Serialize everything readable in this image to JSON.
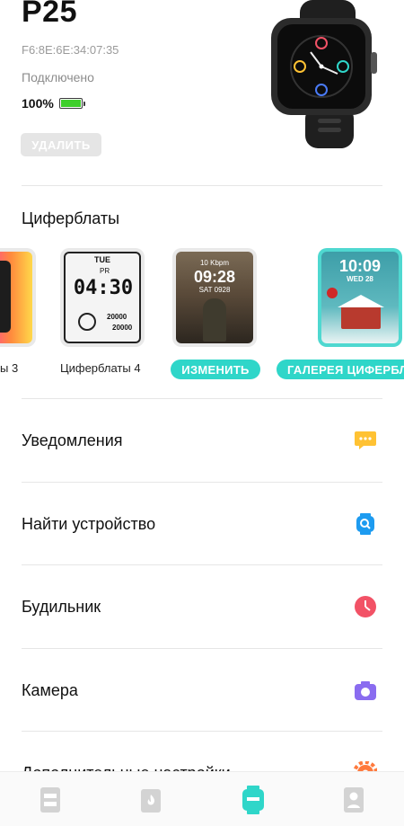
{
  "device": {
    "name": "P25",
    "mac": "F6:8E:6E:34:07:35",
    "status": "Подключено",
    "battery": "100%",
    "battery_level": 1.0,
    "delete_label": "УДАЛИТЬ"
  },
  "faces": {
    "title": "Циферблаты",
    "items": [
      {
        "label": "ы 3"
      },
      {
        "label": "Циферблаты 4",
        "time": "04:30",
        "day": "TUE",
        "ampm": "PR",
        "steps1": "20000",
        "steps2": "20000"
      },
      {
        "label": "",
        "time": "09:28",
        "sub": "10 Kbpm",
        "date": "SAT 0928"
      },
      {
        "label": "",
        "time": "10:09",
        "date": "WED 28"
      }
    ],
    "change_label": "ИЗМЕНИТЬ",
    "gallery_label": "ГАЛЕРЕЯ ЦИФЕРБЛАТОВ"
  },
  "menu": [
    {
      "label": "Уведомления",
      "icon": "message-icon",
      "color": "#ffc233"
    },
    {
      "label": "Найти устройство",
      "icon": "find-device-icon",
      "color": "#1d9bf0"
    },
    {
      "label": "Будильник",
      "icon": "alarm-clock-icon",
      "color": "#f25266"
    },
    {
      "label": "Камера",
      "icon": "camera-icon",
      "color": "#8a6cf0"
    },
    {
      "label": "Дополнительные настройки",
      "icon": "settings-gear-icon",
      "color": "#ff7a3d"
    }
  ],
  "nav": [
    "device-tab-icon",
    "activity-tab-icon",
    "watch-tab-icon",
    "profile-tab-icon"
  ],
  "colors": {
    "accent": "#2fd6c9",
    "battery": "#3fcf2c"
  }
}
